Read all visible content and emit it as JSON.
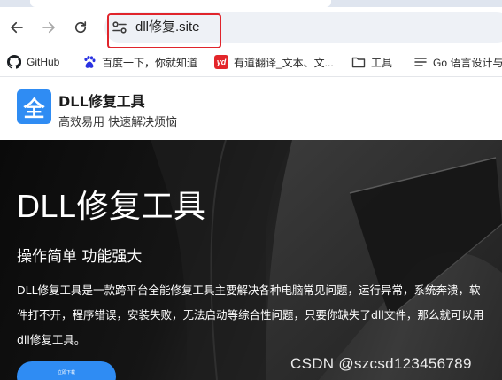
{
  "browser": {
    "address_bar": {
      "url": "dll修复.site"
    },
    "bookmarks": [
      {
        "label": "GitHub",
        "icon": "github-icon"
      },
      {
        "label": "百度一下，你就知道",
        "icon": "baidu-paw-icon"
      },
      {
        "label": "有道翻译_文本、文...",
        "icon": "youdao-icon",
        "icon_text": "yd"
      },
      {
        "label": "工具",
        "icon": "folder-icon"
      },
      {
        "label": "Go 语言设计与",
        "icon": "list-icon"
      }
    ]
  },
  "site_header": {
    "logo_glyph": "全",
    "brand_name": "DLL修复工具",
    "slogan": "高效易用 快速解决烦恼"
  },
  "hero": {
    "title": "DLL修复工具",
    "subtitle": "操作简单 功能强大",
    "description": "DLL修复工具是一款跨平台全能修复工具主要解决各种电脑常见问题，运行异常，系统奔溃，软件打不开，程序错误，安装失败，无法启动等综合性问题，只要你缺失了dll文件，那么就可以用dll修复工具。",
    "download_button": "立即下载"
  },
  "watermark": "CSDN @szcsd123456789",
  "colors": {
    "accent_blue": "#2f8cf3",
    "highlight_red": "#e0242b",
    "youdao_red": "#e3262b",
    "hero_dark": "#111111"
  }
}
